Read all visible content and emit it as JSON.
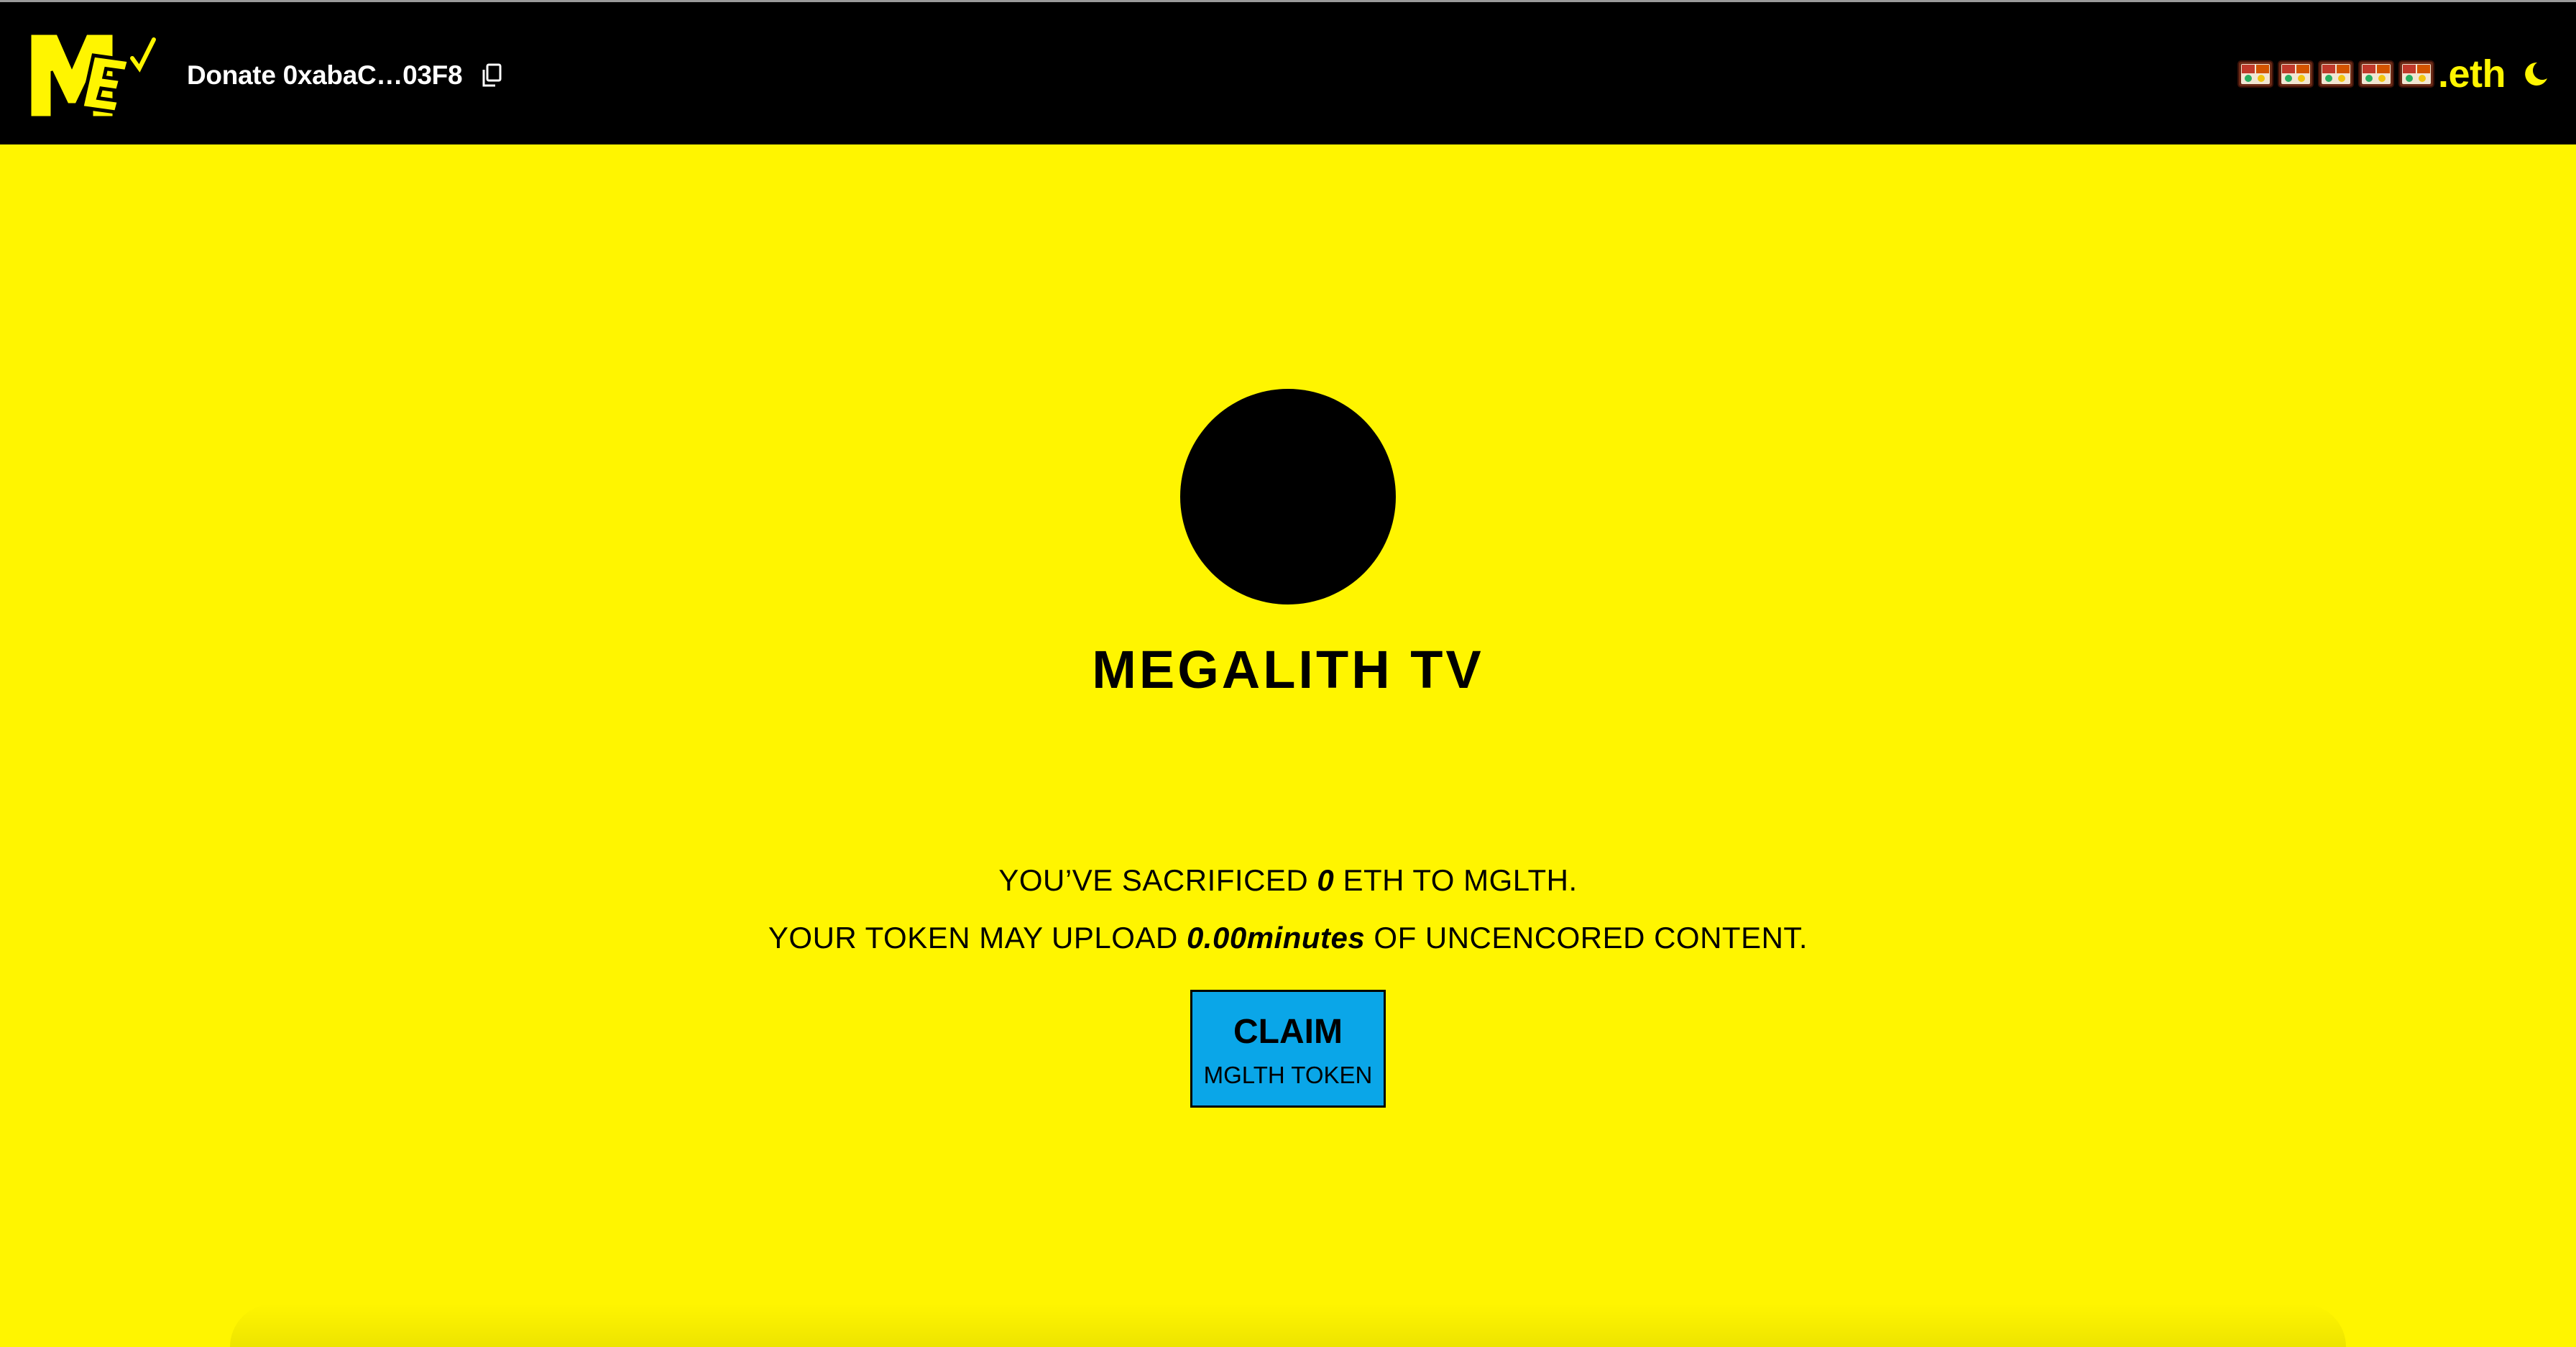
{
  "header": {
    "logo": {
      "icon": "mtv-style-logo-icon",
      "letters": "ME"
    },
    "donate": {
      "label": "Donate 0xabaC…03F8",
      "copy_icon": "copy-icon"
    },
    "ens": {
      "suffix": ".eth",
      "emoji_count": 5
    },
    "theme_toggle": {
      "icon": "moon-icon"
    }
  },
  "main": {
    "title": "MEGALITH TV",
    "sacrificed": {
      "prefix": "YOU’VE SACRIFICED ",
      "value": "0",
      "suffix": " ETH TO MGLTH."
    },
    "upload": {
      "prefix": "YOUR TOKEN MAY UPLOAD ",
      "value": "0.00minutes",
      "suffix": " OF UNCENCORED CONTENT."
    },
    "claim_button": {
      "label": "CLAIM",
      "sublabel": "MGLTH TOKEN"
    }
  },
  "colors": {
    "background": "#fff500",
    "header": "#000000",
    "button": "#0aa6e8",
    "accent": "#fff500"
  }
}
